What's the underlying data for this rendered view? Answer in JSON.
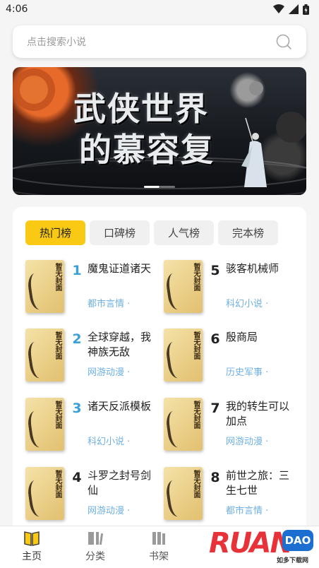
{
  "status": {
    "time": "4:06"
  },
  "search": {
    "placeholder": "点击搜索小说"
  },
  "banner": {
    "title_line1": "武侠世界",
    "title_line2": "的慕容复"
  },
  "tabs": [
    {
      "label": "热门榜",
      "active": true
    },
    {
      "label": "口碑榜",
      "active": false
    },
    {
      "label": "人气榜",
      "active": false
    },
    {
      "label": "完本榜",
      "active": false
    }
  ],
  "cover_text": "暂无封面",
  "books": [
    {
      "rank": "1",
      "title": "魔鬼证道诸天",
      "genre": "都市言情 ·"
    },
    {
      "rank": "2",
      "title": "全球穿越，我神族无敌",
      "genre": "网游动漫 ·"
    },
    {
      "rank": "3",
      "title": "诸天反派模板",
      "genre": "科幻小说 ·"
    },
    {
      "rank": "4",
      "title": "斗罗之封号剑仙",
      "genre": "网游动漫 ·"
    },
    {
      "rank": "5",
      "title": "骇客机械师",
      "genre": "科幻小说 ·"
    },
    {
      "rank": "6",
      "title": "殷商局",
      "genre": "历史军事 ·"
    },
    {
      "rank": "7",
      "title": "我的转生可以加点",
      "genre": "网游动漫 ·"
    },
    {
      "rank": "8",
      "title": "前世之旅：三生七世",
      "genre": "都市言情 ·"
    }
  ],
  "nav": [
    {
      "label": "主页",
      "icon": "book-open-icon",
      "active": true
    },
    {
      "label": "分类",
      "icon": "category-icon",
      "active": false
    },
    {
      "label": "书架",
      "icon": "bookshelf-icon",
      "active": false
    }
  ],
  "watermark": {
    "brand": "RUAN",
    "badge": "DAO",
    "sub": "如多下载网"
  },
  "colors": {
    "accent": "#f9c913",
    "rank_top": "#3b9fd8",
    "genre": "#6fb0e0"
  }
}
